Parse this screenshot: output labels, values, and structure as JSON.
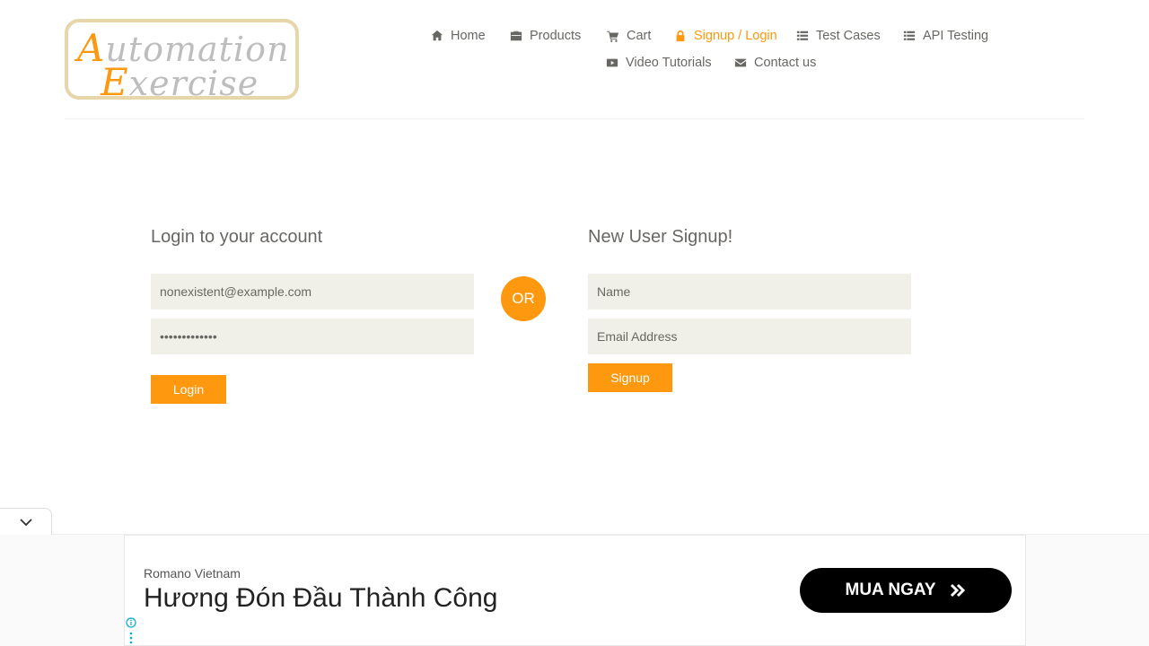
{
  "logo": {
    "line1_cap": "A",
    "line1_rest": "utomation",
    "line2_cap": "E",
    "line2_rest": "xercise"
  },
  "nav": {
    "home": "Home",
    "products": "Products",
    "cart": "Cart",
    "signup_login": "Signup / Login",
    "test_cases": "Test Cases",
    "api_testing": "API Testing",
    "video_tutorials": "Video Tutorials",
    "contact_us": "Contact us"
  },
  "login": {
    "title": "Login to your account",
    "email_value": "nonexistent@example.com",
    "password_value": "•••••••••••••",
    "button": "Login"
  },
  "divider": "OR",
  "signup": {
    "title": "New User Signup!",
    "name_placeholder": "Name",
    "email_placeholder": "Email Address",
    "button": "Signup"
  },
  "ad": {
    "advertiser": "Romano Vietnam",
    "headline": "Hương Đón Đầu Thành Công",
    "cta": "MUA NGAY"
  },
  "colors": {
    "accent": "#fe980f",
    "field_bg": "#f0f0e9",
    "text": "#696763"
  }
}
